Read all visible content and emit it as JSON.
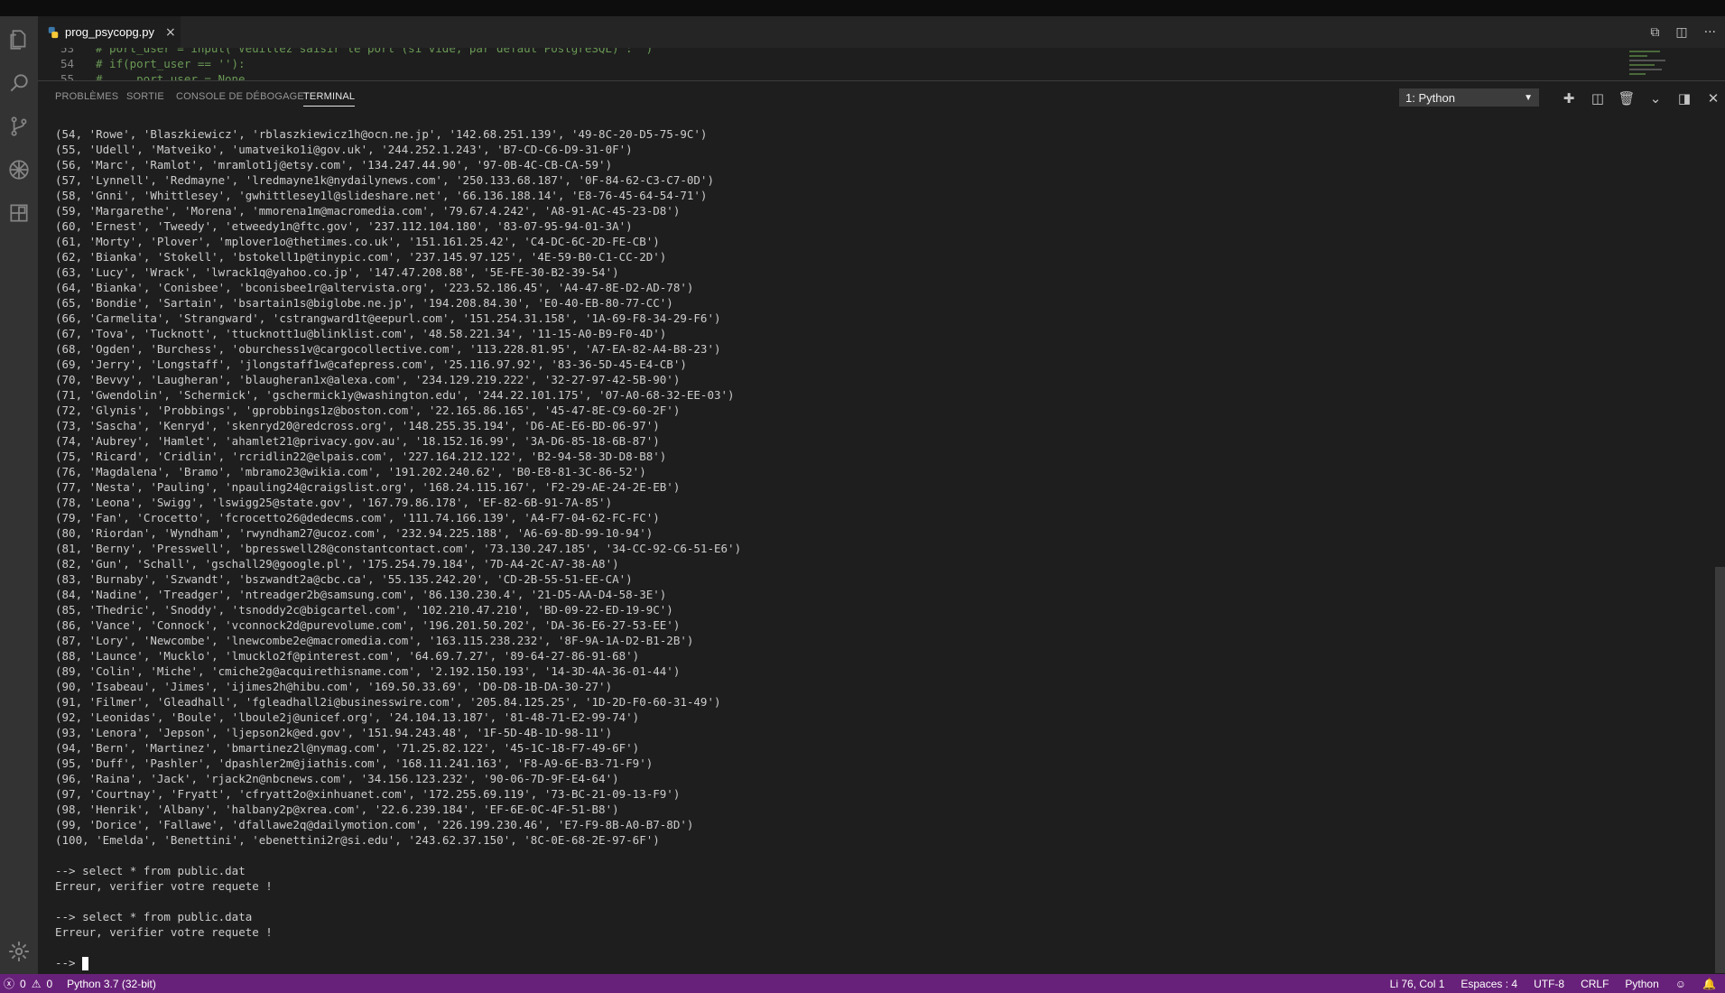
{
  "tab": {
    "filename": "prog_psycopg.py",
    "close": "×"
  },
  "code": {
    "lines": [
      {
        "num": "53",
        "text": "# port_user = input('Veuillez saisir le port (si vide, par defaut PostgreSQL) : ')"
      },
      {
        "num": "54",
        "text": "# if(port_user == ''):"
      },
      {
        "num": "55",
        "text": "#     port_user = None"
      }
    ]
  },
  "panel": {
    "tabs": [
      "PROBLÈMES",
      "SORTIE",
      "CONSOLE DE DÉBOGAGE",
      "TERMINAL"
    ],
    "terminal_select": "1: Python"
  },
  "terminal": {
    "lines": [
      "(54, 'Rowe', 'Blaszkiewicz', 'rblaszkiewicz1h@ocn.ne.jp', '142.68.251.139', '49-8C-20-D5-75-9C')",
      "(55, 'Udell', 'Matveiko', 'umatveiko1i@gov.uk', '244.252.1.243', 'B7-CD-C6-D9-31-0F')",
      "(56, 'Marc', 'Ramlot', 'mramlot1j@etsy.com', '134.247.44.90', '97-0B-4C-CB-CA-59')",
      "(57, 'Lynnell', 'Redmayne', 'lredmayne1k@nydailynews.com', '250.133.68.187', '0F-84-62-C3-C7-0D')",
      "(58, 'Gnni', 'Whittlesey', 'gwhittlesey1l@slideshare.net', '66.136.188.14', 'E8-76-45-64-54-71')",
      "(59, 'Margarethe', 'Morena', 'mmorena1m@macromedia.com', '79.67.4.242', 'A8-91-AC-45-23-D8')",
      "(60, 'Ernest', 'Tweedy', 'etweedy1n@ftc.gov', '237.112.104.180', '83-07-95-94-01-3A')",
      "(61, 'Morty', 'Plover', 'mplover1o@thetimes.co.uk', '151.161.25.42', 'C4-DC-6C-2D-FE-CB')",
      "(62, 'Bianka', 'Stokell', 'bstokell1p@tinypic.com', '237.145.97.125', '4E-59-B0-C1-CC-2D')",
      "(63, 'Lucy', 'Wrack', 'lwrack1q@yahoo.co.jp', '147.47.208.88', '5E-FE-30-B2-39-54')",
      "(64, 'Bianka', 'Conisbee', 'bconisbee1r@altervista.org', '223.52.186.45', 'A4-47-8E-D2-AD-78')",
      "(65, 'Bondie', 'Sartain', 'bsartain1s@biglobe.ne.jp', '194.208.84.30', 'E0-40-EB-80-77-CC')",
      "(66, 'Carmelita', 'Strangward', 'cstrangward1t@eepurl.com', '151.254.31.158', '1A-69-F8-34-29-F6')",
      "(67, 'Tova', 'Tucknott', 'ttucknott1u@blinklist.com', '48.58.221.34', '11-15-A0-B9-F0-4D')",
      "(68, 'Ogden', 'Burchess', 'oburchess1v@cargocollective.com', '113.228.81.95', 'A7-EA-82-A4-B8-23')",
      "(69, 'Jerry', 'Longstaff', 'jlongstaff1w@cafepress.com', '25.116.97.92', '83-36-5D-45-E4-CB')",
      "(70, 'Bevvy', 'Laugheran', 'blaugheran1x@alexa.com', '234.129.219.222', '32-27-97-42-5B-90')",
      "(71, 'Gwendolin', 'Schermick', 'gschermick1y@washington.edu', '244.22.101.175', '07-A0-68-32-EE-03')",
      "(72, 'Glynis', 'Probbings', 'gprobbings1z@boston.com', '22.165.86.165', '45-47-8E-C9-60-2F')",
      "(73, 'Sascha', 'Kenryd', 'skenryd20@redcross.org', '148.255.35.194', 'D6-AE-E6-BD-06-97')",
      "(74, 'Aubrey', 'Hamlet', 'ahamlet21@privacy.gov.au', '18.152.16.99', '3A-D6-85-18-6B-87')",
      "(75, 'Ricard', 'Cridlin', 'rcridlin22@elpais.com', '227.164.212.122', 'B2-94-58-3D-D8-B8')",
      "(76, 'Magdalena', 'Bramo', 'mbramo23@wikia.com', '191.202.240.62', 'B0-E8-81-3C-86-52')",
      "(77, 'Nesta', 'Pauling', 'npauling24@craigslist.org', '168.24.115.167', 'F2-29-AE-24-2E-EB')",
      "(78, 'Leona', 'Swigg', 'lswigg25@state.gov', '167.79.86.178', 'EF-82-6B-91-7A-85')",
      "(79, 'Fan', 'Crocetto', 'fcrocetto26@dedecms.com', '111.74.166.139', 'A4-F7-04-62-FC-FC')",
      "(80, 'Riordan', 'Wyndham', 'rwyndham27@ucoz.com', '232.94.225.188', 'A6-69-8D-99-10-94')",
      "(81, 'Berny', 'Presswell', 'bpresswell28@constantcontact.com', '73.130.247.185', '34-CC-92-C6-51-E6')",
      "(82, 'Gun', 'Schall', 'gschall29@google.pl', '175.254.79.184', '7D-A4-2C-A7-38-A8')",
      "(83, 'Burnaby', 'Szwandt', 'bszwandt2a@cbc.ca', '55.135.242.20', 'CD-2B-55-51-EE-CA')",
      "(84, 'Nadine', 'Treadger', 'ntreadger2b@samsung.com', '86.130.230.4', '21-D5-AA-D4-58-3E')",
      "(85, 'Thedric', 'Snoddy', 'tsnoddy2c@bigcartel.com', '102.210.47.210', 'BD-09-22-ED-19-9C')",
      "(86, 'Vance', 'Connock', 'vconnock2d@purevolume.com', '196.201.50.202', 'DA-36-E6-27-53-EE')",
      "(87, 'Lory', 'Newcombe', 'lnewcombe2e@macromedia.com', '163.115.238.232', '8F-9A-1A-D2-B1-2B')",
      "(88, 'Launce', 'Mucklo', 'lmucklo2f@pinterest.com', '64.69.7.27', '89-64-27-86-91-68')",
      "(89, 'Colin', 'Miche', 'cmiche2g@acquirethisname.com', '2.192.150.193', '14-3D-4A-36-01-44')",
      "(90, 'Isabeau', 'Jimes', 'ijimes2h@hibu.com', '169.50.33.69', 'D0-D8-1B-DA-30-27')",
      "(91, 'Filmer', 'Gleadhall', 'fgleadhall2i@businesswire.com', '205.84.125.25', '1D-2D-F0-60-31-49')",
      "(92, 'Leonidas', 'Boule', 'lboule2j@unicef.org', '24.104.13.187', '81-48-71-E2-99-74')",
      "(93, 'Lenora', 'Jepson', 'ljepson2k@ed.gov', '151.94.243.48', '1F-5D-4B-1D-98-11')",
      "(94, 'Bern', 'Martinez', 'bmartinez2l@nymag.com', '71.25.82.122', '45-1C-18-F7-49-6F')",
      "(95, 'Duff', 'Pashler', 'dpashler2m@jiathis.com', '168.11.241.163', 'F8-A9-6E-B3-71-F9')",
      "(96, 'Raina', 'Jack', 'rjack2n@nbcnews.com', '34.156.123.232', '90-06-7D-9F-E4-64')",
      "(97, 'Courtnay', 'Fryatt', 'cfryatt2o@xinhuanet.com', '172.255.69.119', '73-BC-21-09-13-F9')",
      "(98, 'Henrik', 'Albany', 'halbany2p@xrea.com', '22.6.239.184', 'EF-6E-0C-4F-51-B8')",
      "(99, 'Dorice', 'Fallawe', 'dfallawe2q@dailymotion.com', '226.199.230.46', 'E7-F9-8B-A0-B7-8D')",
      "(100, 'Emelda', 'Benettini', 'ebenettini2r@si.edu', '243.62.37.150', '8C-0E-68-2E-97-6F')",
      "",
      "--> select * from public.dat",
      "Erreur, verifier votre requete !",
      "",
      "--> select * from public.data",
      "Erreur, verifier votre requete !",
      ""
    ],
    "prompt": "--> "
  },
  "status": {
    "errors": "0",
    "warnings": "0",
    "interpreter": "Python 3.7 (32-bit)",
    "position": "Li 76, Col 1",
    "spaces": "Espaces : 4",
    "encoding": "UTF-8",
    "eol": "CRLF",
    "language": "Python"
  },
  "colors": {
    "statusbar": "#68217a",
    "activitybar": "#333333",
    "editor": "#1e1e1e",
    "comment": "#6a9955"
  }
}
